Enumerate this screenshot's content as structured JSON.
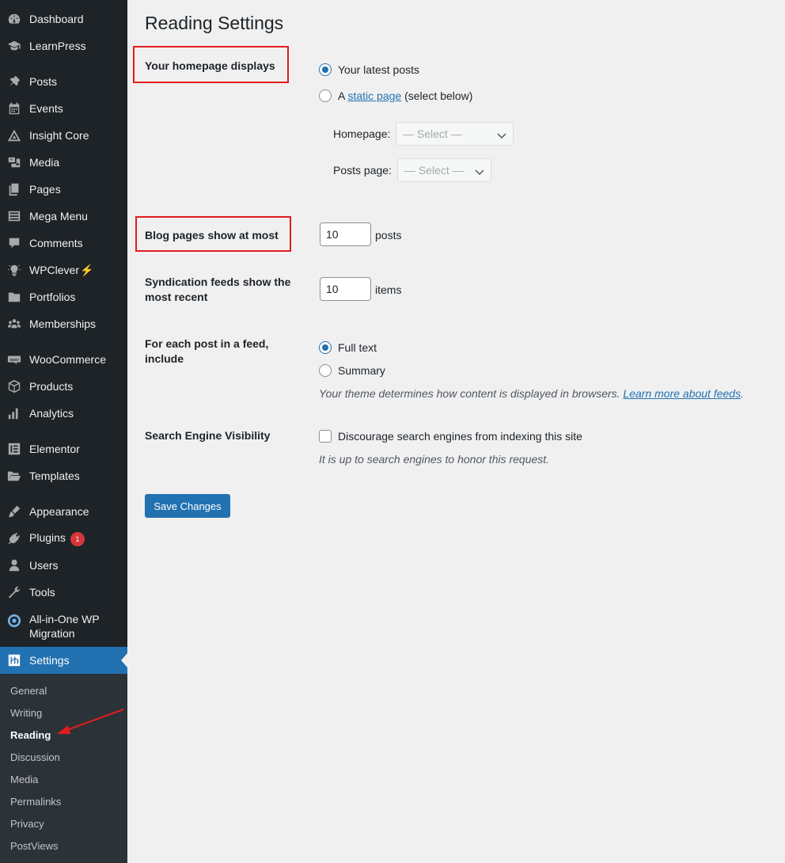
{
  "sidebar": {
    "items": [
      {
        "label": "Dashboard",
        "icon": "dashboard-icon"
      },
      {
        "label": "LearnPress",
        "icon": "graduation-cap-icon"
      },
      {
        "label": "Posts",
        "icon": "pin-icon"
      },
      {
        "label": "Events",
        "icon": "calendar-icon"
      },
      {
        "label": "Insight Core",
        "icon": "insight-core-icon"
      },
      {
        "label": "Media",
        "icon": "media-icon"
      },
      {
        "label": "Pages",
        "icon": "pages-icon"
      },
      {
        "label": "Mega Menu",
        "icon": "list-icon"
      },
      {
        "label": "Comments",
        "icon": "comment-icon"
      },
      {
        "label": "WPClever",
        "badge_glyph": "⚡",
        "icon": "lightbulb-icon"
      },
      {
        "label": "Portfolios",
        "icon": "folder-icon"
      },
      {
        "label": "Memberships",
        "icon": "groups-icon"
      },
      {
        "label": "WooCommerce",
        "icon": "woocommerce-icon"
      },
      {
        "label": "Products",
        "icon": "box-icon"
      },
      {
        "label": "Analytics",
        "icon": "bar-chart-icon"
      },
      {
        "label": "Elementor",
        "icon": "elementor-icon"
      },
      {
        "label": "Templates",
        "icon": "folder-open-icon"
      },
      {
        "label": "Appearance",
        "icon": "brush-icon"
      },
      {
        "label": "Plugins",
        "badge": "1",
        "icon": "plug-icon"
      },
      {
        "label": "Users",
        "icon": "user-icon"
      },
      {
        "label": "Tools",
        "icon": "wrench-icon"
      },
      {
        "label": "All-in-One WP Migration",
        "icon": "migration-icon"
      },
      {
        "label": "Settings",
        "icon": "settings-icon"
      }
    ],
    "submenu": [
      "General",
      "Writing",
      "Reading",
      "Discussion",
      "Media",
      "Permalinks",
      "Privacy",
      "PostViews"
    ],
    "current_submenu": "Reading"
  },
  "page": {
    "title": "Reading Settings",
    "homepage_displays": {
      "label": "Your homepage displays",
      "option_latest": "Your latest posts",
      "option_static_prefix": "A",
      "option_static_link": "static page",
      "option_static_suffix": "(select below)",
      "selected": "latest",
      "homepage_label": "Homepage:",
      "homepage_value": "— Select —",
      "posts_page_label": "Posts page:",
      "posts_page_value": "— Select —"
    },
    "blog_pages": {
      "label": "Blog pages show at most",
      "value": "10",
      "unit": "posts"
    },
    "syndication": {
      "label": "Syndication feeds show the most recent",
      "value": "10",
      "unit": "items"
    },
    "feed_include": {
      "label": "For each post in a feed, include",
      "option_full": "Full text",
      "option_summary": "Summary",
      "selected": "full",
      "desc": "Your theme determines how content is displayed in browsers.",
      "desc_link": "Learn more about feeds",
      "desc_end": "."
    },
    "search_visibility": {
      "label": "Search Engine Visibility",
      "checkbox_label": "Discourage search engines from indexing this site",
      "checked": false,
      "desc": "It is up to search engines to honor this request."
    },
    "save_button": "Save Changes"
  },
  "colors": {
    "sidebar_bg": "#1d2327",
    "submenu_bg": "#2c3338",
    "accent": "#2271b1",
    "highlight_box": "#e11d1d",
    "badge": "#d63638"
  }
}
